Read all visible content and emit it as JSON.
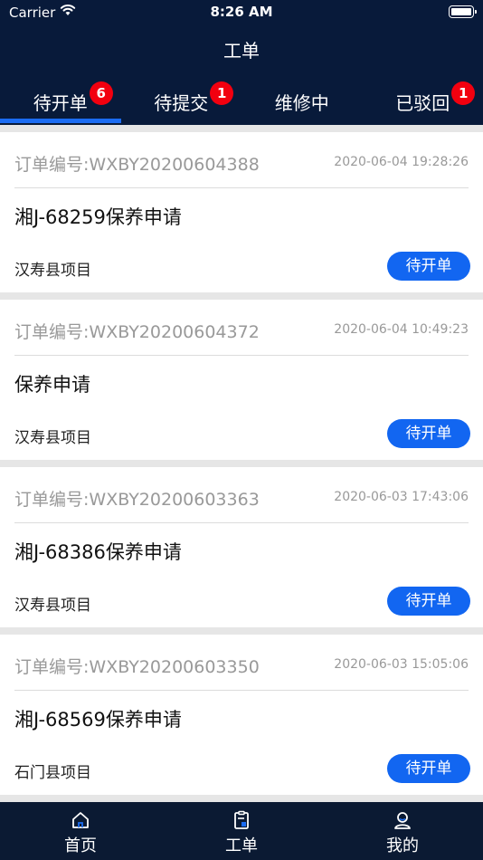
{
  "status_bar": {
    "carrier": "Carrier",
    "time": "8:26 AM"
  },
  "nav": {
    "title": "工单"
  },
  "tabs": [
    {
      "label": "待开单",
      "badge": "6",
      "active": true
    },
    {
      "label": "待提交",
      "badge": "1",
      "active": false
    },
    {
      "label": "维修中",
      "badge": null,
      "active": false
    },
    {
      "label": "已驳回",
      "badge": "1",
      "active": false
    }
  ],
  "orders": [
    {
      "order_no": "订单编号:WXBY20200604388",
      "time": "2020-06-04 19:28:26",
      "title": "湘J-68259保养申请",
      "project": "汉寿县项目",
      "status": "待开单"
    },
    {
      "order_no": "订单编号:WXBY20200604372",
      "time": "2020-06-04 10:49:23",
      "title": "保养申请",
      "project": "汉寿县项目",
      "status": "待开单"
    },
    {
      "order_no": "订单编号:WXBY20200603363",
      "time": "2020-06-03 17:43:06",
      "title": "湘J-68386保养申请",
      "project": "汉寿县项目",
      "status": "待开单"
    },
    {
      "order_no": "订单编号:WXBY20200603350",
      "time": "2020-06-03 15:05:06",
      "title": "湘J-68569保养申请",
      "project": "石门县项目",
      "status": "待开单"
    }
  ],
  "tabbar": [
    {
      "label": "首页",
      "icon": "home-icon"
    },
    {
      "label": "工单",
      "icon": "clipboard-icon"
    },
    {
      "label": "我的",
      "icon": "user-icon"
    }
  ],
  "colors": {
    "header_bg": "#081a3a",
    "accent": "#1266f1",
    "badge": "#f2000f",
    "tabbar_bg": "#0b1a33"
  }
}
